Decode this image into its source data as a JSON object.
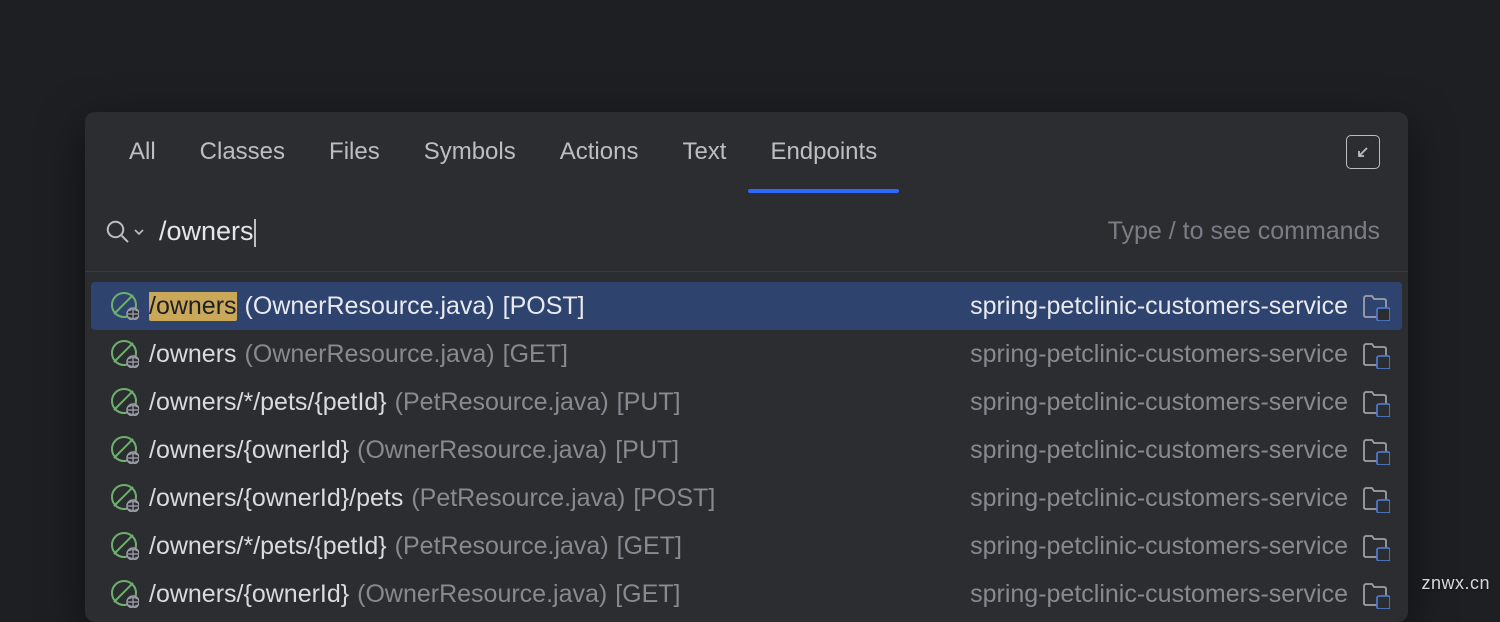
{
  "tabs": {
    "items": [
      {
        "label": "All",
        "active": false
      },
      {
        "label": "Classes",
        "active": false
      },
      {
        "label": "Files",
        "active": false
      },
      {
        "label": "Symbols",
        "active": false
      },
      {
        "label": "Actions",
        "active": false
      },
      {
        "label": "Text",
        "active": false
      },
      {
        "label": "Endpoints",
        "active": true
      }
    ]
  },
  "search": {
    "value": "/owners",
    "hint": "Type / to see commands"
  },
  "results": [
    {
      "path": "/owners",
      "file": "(OwnerResource.java)",
      "method": "[POST]",
      "module": "spring-petclinic-customers-service",
      "selected": true,
      "highlight_end": 7
    },
    {
      "path": "/owners",
      "file": "(OwnerResource.java)",
      "method": "[GET]",
      "module": "spring-petclinic-customers-service",
      "selected": false
    },
    {
      "path": "/owners/*/pets/{petId}",
      "file": "(PetResource.java)",
      "method": "[PUT]",
      "module": "spring-petclinic-customers-service",
      "selected": false
    },
    {
      "path": "/owners/{ownerId}",
      "file": "(OwnerResource.java)",
      "method": "[PUT]",
      "module": "spring-petclinic-customers-service",
      "selected": false
    },
    {
      "path": "/owners/{ownerId}/pets",
      "file": "(PetResource.java)",
      "method": "[POST]",
      "module": "spring-petclinic-customers-service",
      "selected": false
    },
    {
      "path": "/owners/*/pets/{petId}",
      "file": "(PetResource.java)",
      "method": "[GET]",
      "module": "spring-petclinic-customers-service",
      "selected": false
    },
    {
      "path": "/owners/{ownerId}",
      "file": "(OwnerResource.java)",
      "method": "[GET]",
      "module": "spring-petclinic-customers-service",
      "selected": false
    }
  ],
  "watermark": "znwx.cn"
}
